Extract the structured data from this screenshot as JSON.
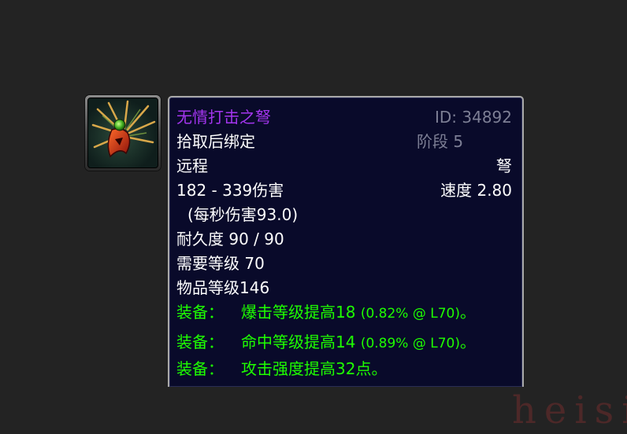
{
  "item": {
    "name": "无情打击之弩",
    "id_text": "ID: 34892",
    "binding": "拾取后绑定",
    "tier": "阶段 5",
    "slot": "远程",
    "type": "弩",
    "damage": "182 - 339伤害",
    "speed": "速度 2.80",
    "dps": "(每秒伤害93.0)",
    "durability": "耐久度 90 / 90",
    "required_level": "需要等级 70",
    "item_level": "物品等级146",
    "icon": "crossbow-icon",
    "equip": [
      {
        "label": "装备：",
        "text": "爆击等级提高18",
        "detail": "(0.82% @ L70)",
        "end": "。"
      },
      {
        "label": "装备：",
        "text": "命中等级提高14",
        "detail": "(0.89% @ L70)",
        "end": "。"
      },
      {
        "label": "装备：",
        "text": "攻击强度提高32点",
        "detail": "",
        "end": "。"
      }
    ]
  },
  "colors": {
    "epic": "#a335ee",
    "equip": "#1eff00",
    "muted": "#7d7f95",
    "tooltip_bg": "#090a2a"
  },
  "watermark": "heisi"
}
